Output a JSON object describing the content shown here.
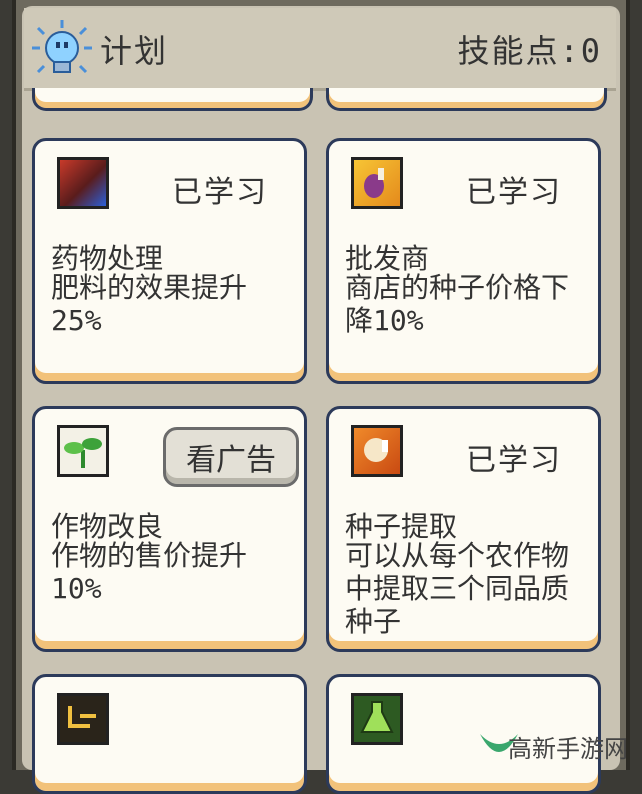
{
  "header": {
    "title": "计划",
    "skill_points": "技能点:0"
  },
  "cards": [
    {
      "name": "药物处理",
      "desc": "肥料的效果提升25%",
      "status": "已学习"
    },
    {
      "name": "批发商",
      "desc": "商店的种子价格下降10%",
      "status": "已学习"
    },
    {
      "name": "作物改良",
      "desc": "作物的售价提升10%",
      "status": "看广告"
    },
    {
      "name": "种子提取",
      "desc": "可以从每个农作物中提取三个同品质种子",
      "status": "已学习"
    }
  ],
  "watermark": "高新手游网",
  "colors": {
    "card_bg": "#fdfbf3",
    "card_border": "#2c3a5a",
    "card_accent": "#f2c27a",
    "panel_bg": "#c9c3b3"
  }
}
